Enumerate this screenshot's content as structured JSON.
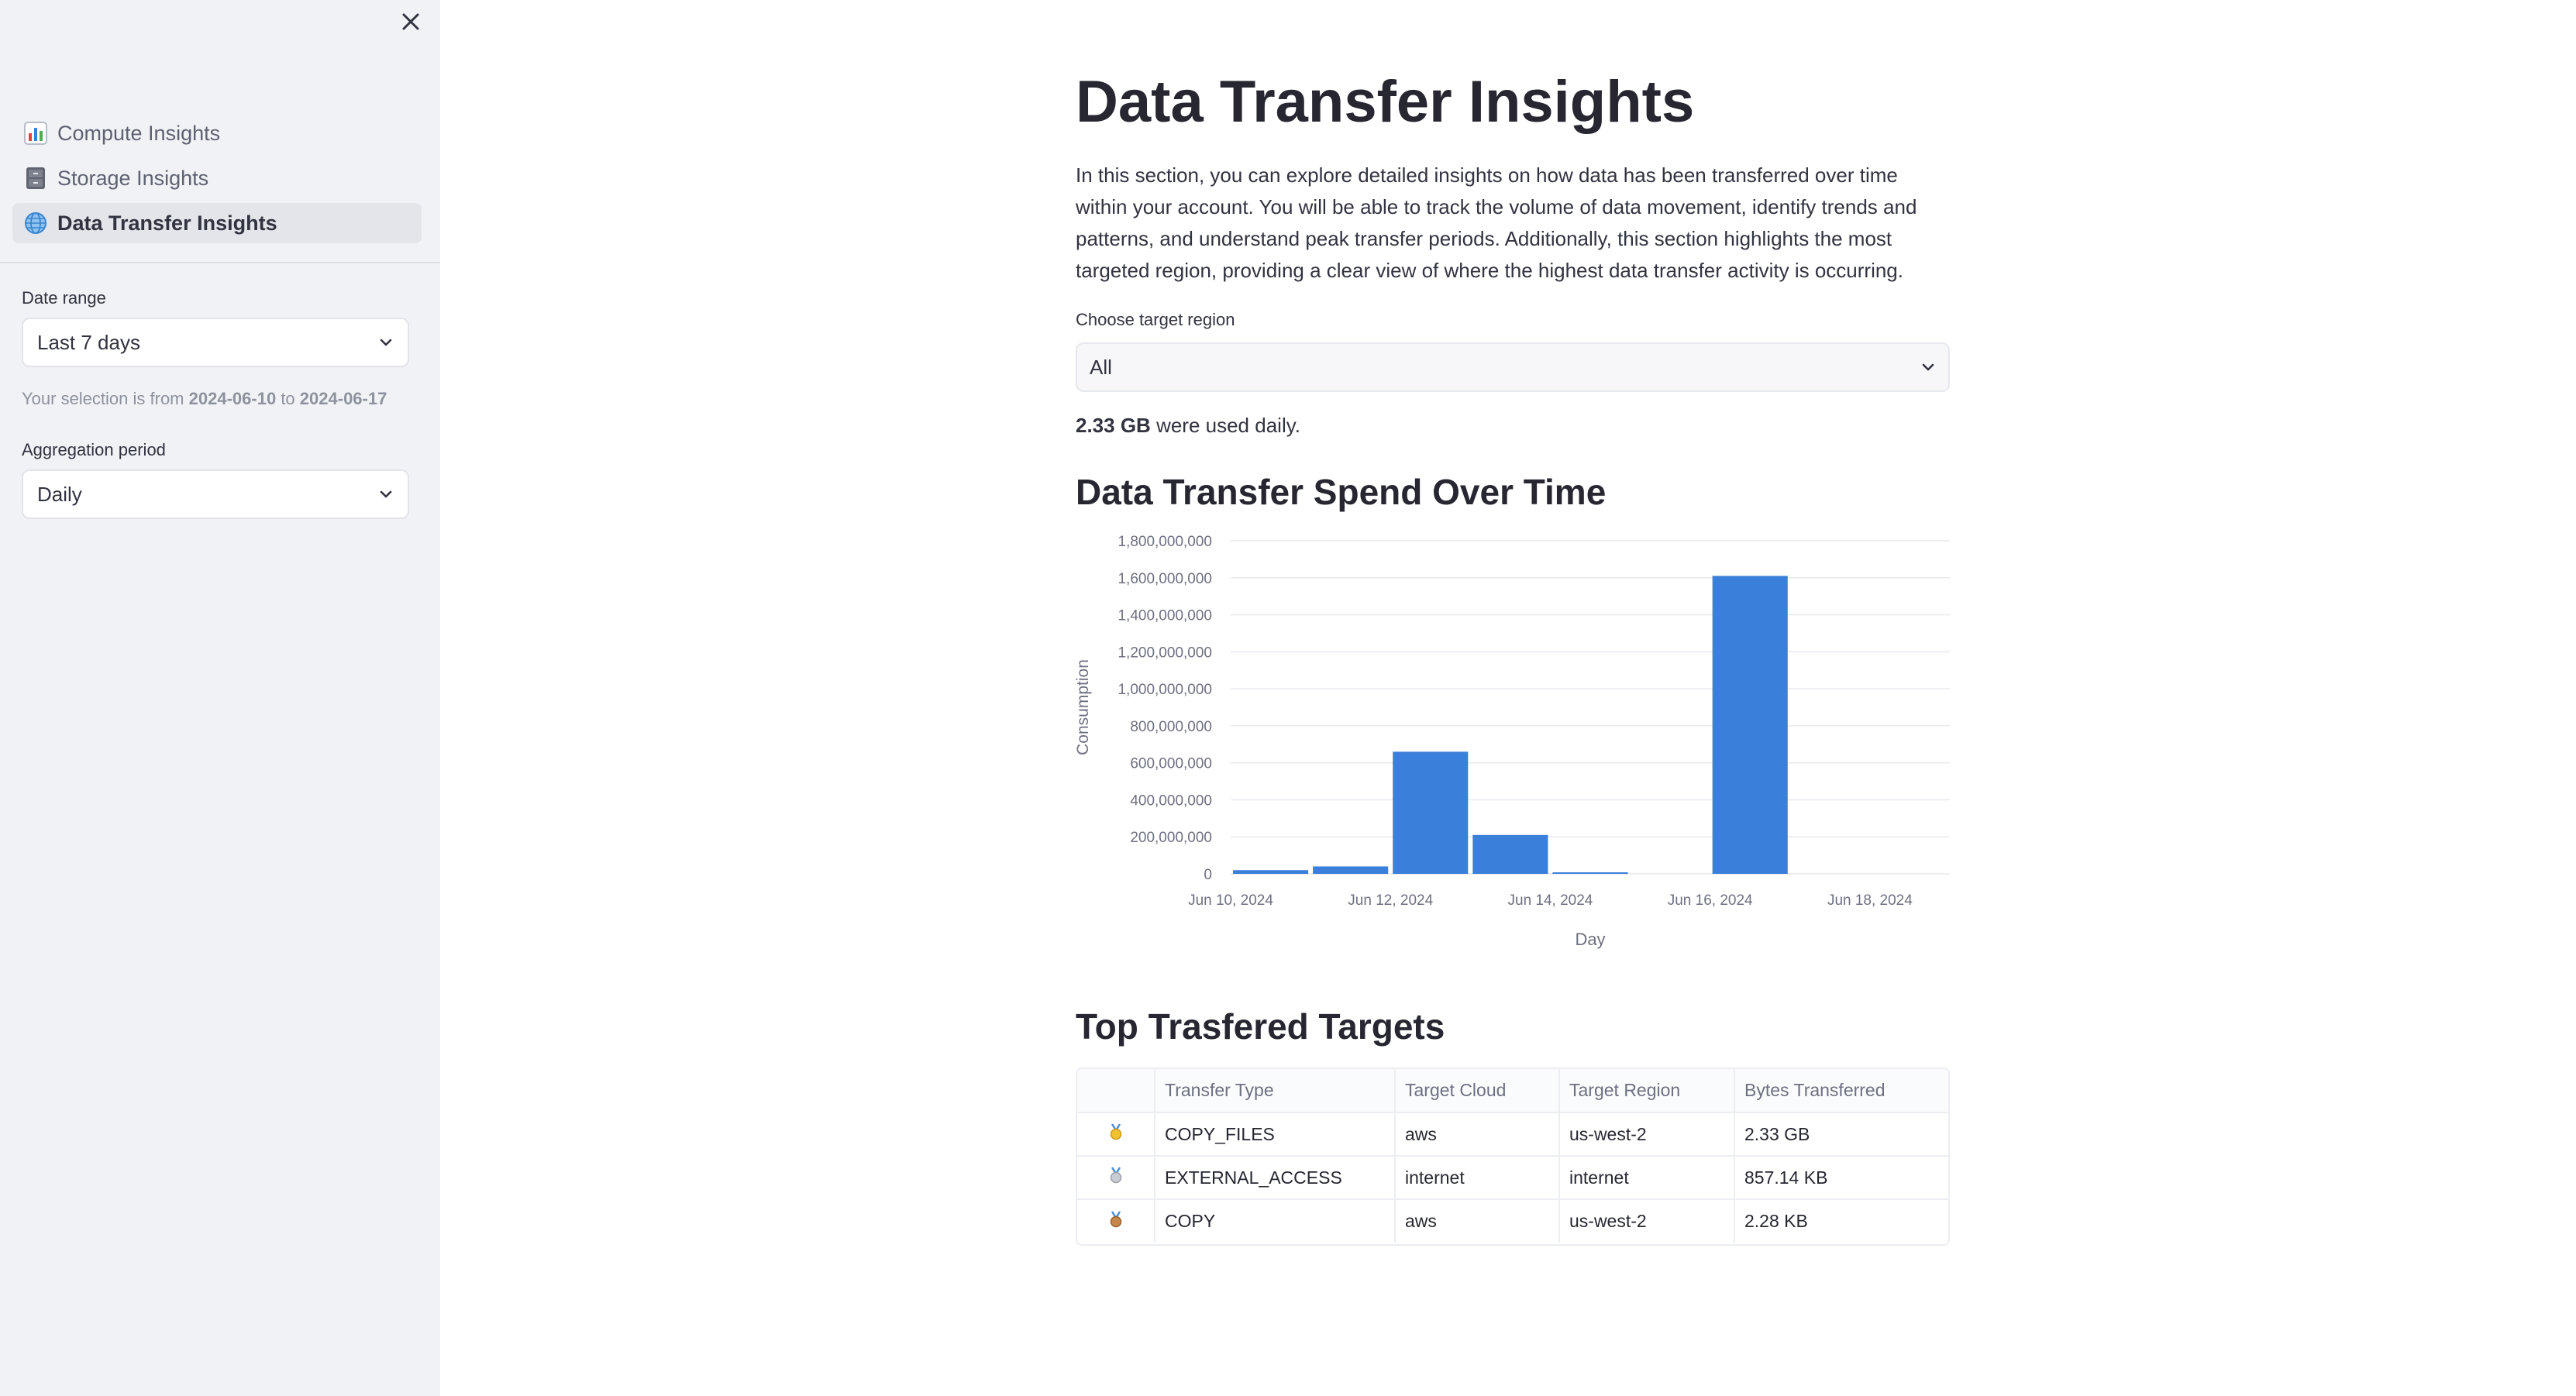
{
  "sidebar": {
    "nav": [
      {
        "label": "Compute Insights",
        "icon": "bar-chart-icon",
        "active": false
      },
      {
        "label": "Storage Insights",
        "icon": "file-cabinet-icon",
        "active": false
      },
      {
        "label": "Data Transfer Insights",
        "icon": "globe-icon",
        "active": true
      }
    ],
    "date_range": {
      "label": "Date range",
      "value": "Last 7 days"
    },
    "selection_note": {
      "prefix": "Your selection is from",
      "start": "2024-06-10",
      "joiner": "to",
      "end": "2024-06-17"
    },
    "aggregation": {
      "label": "Aggregation period",
      "value": "Daily"
    }
  },
  "main": {
    "title": "Data Transfer Insights",
    "intro": "In this section, you can explore detailed insights on how data has been transferred over time within your account. You will be able to track the volume of data movement, identify trends and patterns, and understand peak transfer periods. Additionally, this section highlights the most targeted region, providing a clear view of where the highest data transfer activity is occurring.",
    "region": {
      "label": "Choose target region",
      "value": "All"
    },
    "usage": {
      "amount": "2.33 GB",
      "suffix": "were used daily."
    },
    "chart_title": "Data Transfer Spend Over Time",
    "table_title": "Top Trasfered Targets",
    "table": {
      "columns": [
        "",
        "Transfer Type",
        "Target Cloud",
        "Target Region",
        "Bytes Transferred"
      ],
      "rows": [
        {
          "medal": "gold",
          "type": "COPY_FILES",
          "cloud": "aws",
          "region": "us-west-2",
          "bytes": "2.33 GB"
        },
        {
          "medal": "silver",
          "type": "EXTERNAL_ACCESS",
          "cloud": "internet",
          "region": "internet",
          "bytes": "857.14 KB"
        },
        {
          "medal": "bronze",
          "type": "COPY",
          "cloud": "aws",
          "region": "us-west-2",
          "bytes": "2.28 KB"
        }
      ]
    }
  },
  "colors": {
    "bar": "#3a7fd9",
    "accent": "#ff4b4b"
  },
  "chart_data": {
    "type": "bar",
    "categories": [
      "Jun 10, 2024",
      "Jun 11, 2024",
      "Jun 12, 2024",
      "Jun 13, 2024",
      "Jun 14, 2024",
      "Jun 15, 2024",
      "Jun 16, 2024",
      "Jun 17, 2024"
    ],
    "values": [
      20000000,
      40000000,
      660000000,
      210000000,
      3000000,
      0,
      1610000000,
      0
    ],
    "xlabel": "Day",
    "ylabel": "Consumption",
    "ylim": [
      0,
      1800000000
    ],
    "yticks": [
      0,
      200000000,
      400000000,
      600000000,
      800000000,
      1000000000,
      1200000000,
      1400000000,
      1600000000,
      1800000000
    ],
    "xticks": [
      "Jun 10, 2024",
      "Jun 12, 2024",
      "Jun 14, 2024",
      "Jun 16, 2024",
      "Jun 18, 2024"
    ],
    "grid": true,
    "legend": "none"
  }
}
